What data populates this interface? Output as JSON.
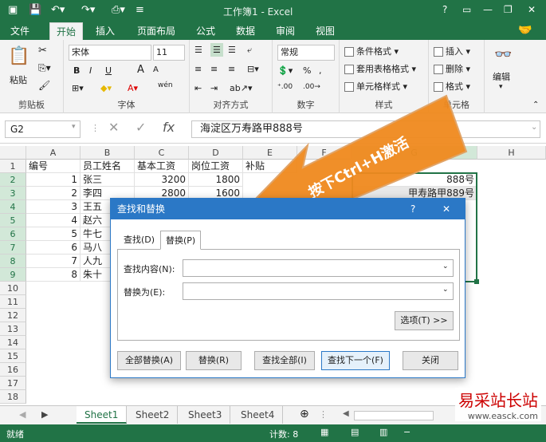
{
  "title_bar": {
    "title": "工作簿1 - Excel",
    "help": "?",
    "minimize": "—",
    "restore": "❐",
    "close": "✕"
  },
  "ribbon_tabs": [
    "文件",
    "开始",
    "插入",
    "页面布局",
    "公式",
    "数据",
    "审阅",
    "视图"
  ],
  "clipboard": {
    "paste": "粘贴",
    "label": "剪贴板"
  },
  "font": {
    "name": "宋体",
    "size": "11",
    "bold": "B",
    "italic": "I",
    "underline": "U",
    "grow": "A",
    "shrink": "A",
    "phonetic": "wén",
    "label": "字体"
  },
  "alignment": {
    "label": "对齐方式"
  },
  "number": {
    "format": "常规",
    "percent": "%",
    "comma": ",",
    "label": "数字"
  },
  "styles": {
    "conditional": "条件格式",
    "as_table": "套用表格格式",
    "cell_styles": "单元格样式",
    "label": "样式"
  },
  "cells": {
    "insert": "插入",
    "delete": "删除",
    "format": "格式",
    "label": "单元格"
  },
  "editing": {
    "label": "编辑"
  },
  "formula_bar": {
    "name_box": "G2",
    "cancel": "✕",
    "enter": "✓",
    "fx": "fx",
    "content": "海淀区万寿路甲888号"
  },
  "columns": [
    "A",
    "B",
    "C",
    "D",
    "E",
    "F",
    "G",
    "H"
  ],
  "rows": [
    "1",
    "2",
    "3",
    "4",
    "5",
    "6",
    "7",
    "8",
    "9",
    "10",
    "11",
    "12",
    "13",
    "14",
    "15",
    "16",
    "17",
    "18"
  ],
  "headers": [
    "编号",
    "员工姓名",
    "基本工资",
    "岗位工资",
    "补贴"
  ],
  "data_rows": [
    {
      "id": "1",
      "name": "张三",
      "base": "3200",
      "post": "1800"
    },
    {
      "id": "2",
      "name": "李四",
      "base": "2800",
      "post": "1600"
    },
    {
      "id": "3",
      "name": "王五"
    },
    {
      "id": "4",
      "name": "赵六"
    },
    {
      "id": "5",
      "name": "牛七"
    },
    {
      "id": "6",
      "name": "马八"
    },
    {
      "id": "7",
      "name": "人九"
    },
    {
      "id": "8",
      "name": "朱十"
    }
  ],
  "visible_g": [
    "888号",
    "甲寿路甲889号"
  ],
  "dialog": {
    "title": "查找和替换",
    "help": "?",
    "close": "✕",
    "tab_find": "查找(D)",
    "tab_replace": "替换(P)",
    "find_label": "查找内容(N):",
    "replace_label": "替换为(E):",
    "options": "选项(T) >>",
    "replace_all": "全部替换(A)",
    "replace": "替换(R)",
    "find_all": "查找全部(I)",
    "find_next": "查找下一个(F)",
    "close_btn": "关闭"
  },
  "callout": "按下Ctrl+H激活",
  "sheets": [
    "Sheet1",
    "Sheet2",
    "Sheet3",
    "Sheet4"
  ],
  "status": {
    "ready": "就绪",
    "count": "计数: 8"
  },
  "watermark": {
    "cn": "易采站长站",
    "url": "www.easck.com"
  }
}
